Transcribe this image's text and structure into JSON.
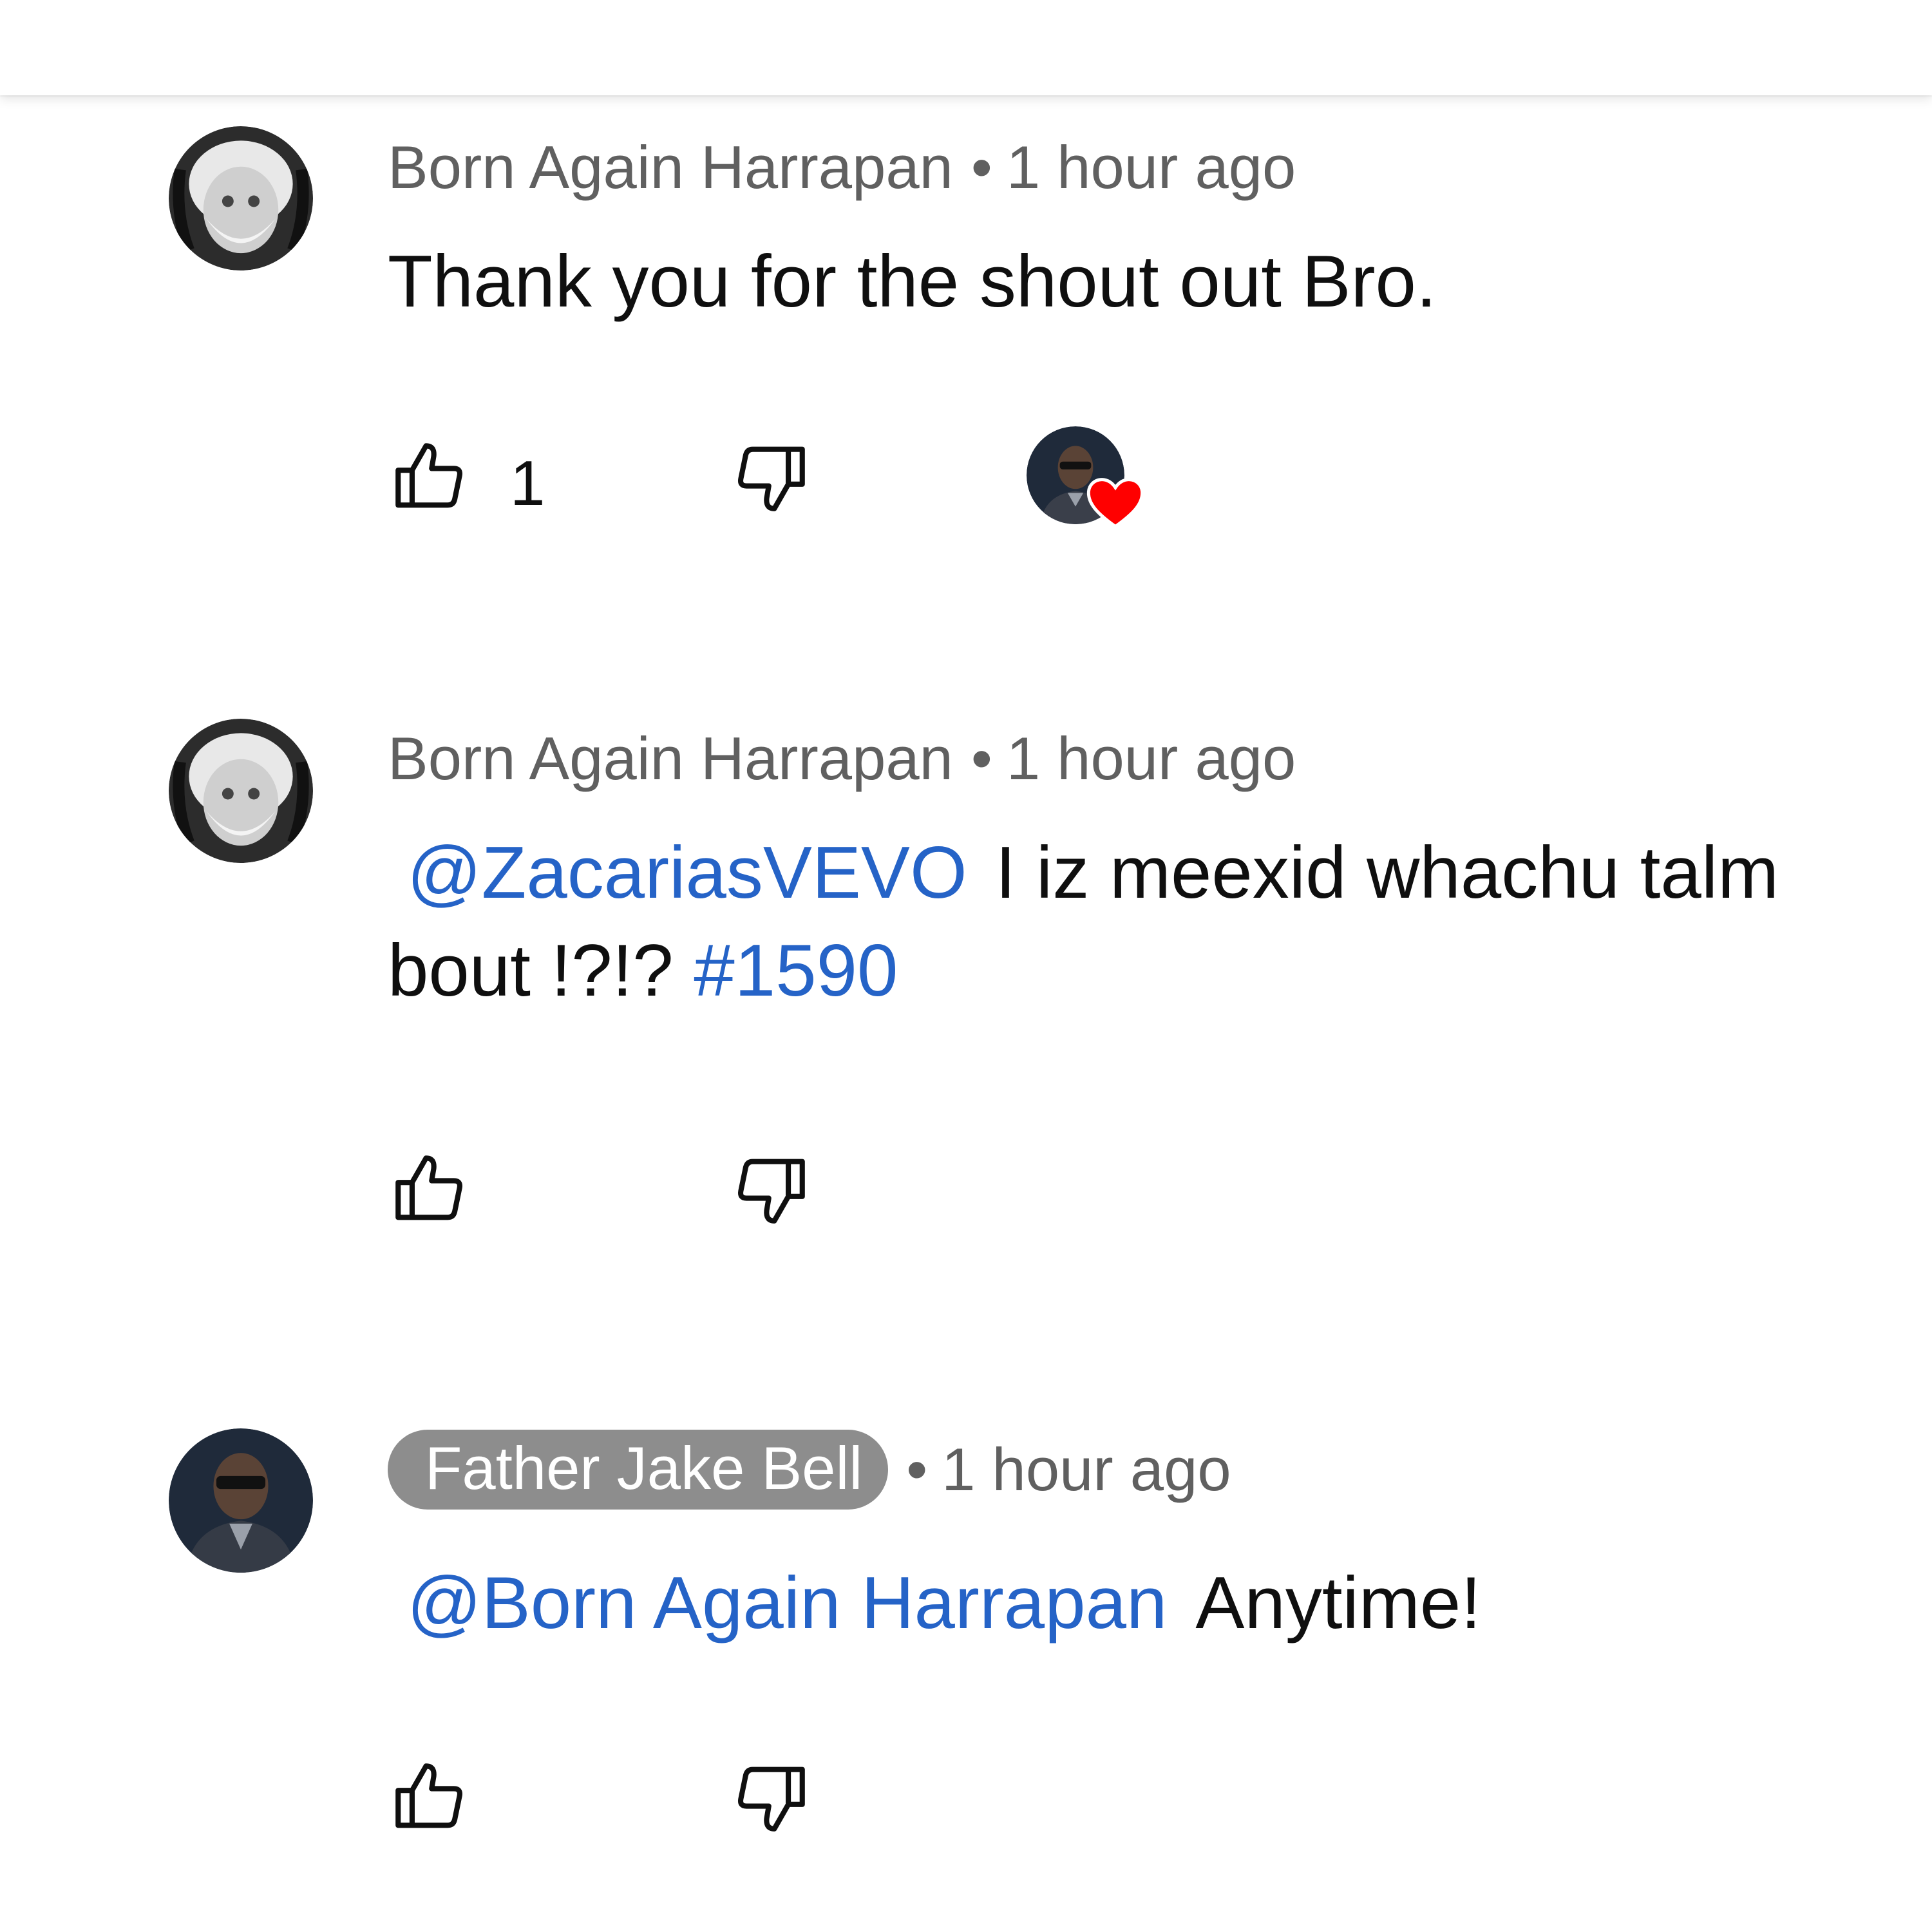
{
  "comments": [
    {
      "author": "Born Again Harrapan",
      "separator": "•",
      "time": "1 hour ago",
      "text": "Thank you for the shout out Bro.",
      "like_count": "1",
      "hearted_by_creator": true
    },
    {
      "author": "Born Again Harrapan",
      "separator": "•",
      "time": "1 hour ago",
      "mention": "@ZacariasVEVO",
      "text_after_mention": "I iz meexid whachu talm bout !?!?",
      "hashtag": "#1590"
    },
    {
      "author": "Father Jake Bell",
      "author_is_channel_owner": true,
      "separator": "•",
      "time": "1 hour ago",
      "mention": "@Born Again Harrapan",
      "text_after_mention": "Anytime!"
    }
  ],
  "icons": {
    "like": "thumbs-up-icon",
    "dislike": "thumbs-down-icon",
    "creator_heart": "heart-icon"
  },
  "colors": {
    "link": "#2563c7",
    "meta_text": "#606060",
    "owner_chip": "#8d8d8d",
    "heart": "#ff0000"
  }
}
